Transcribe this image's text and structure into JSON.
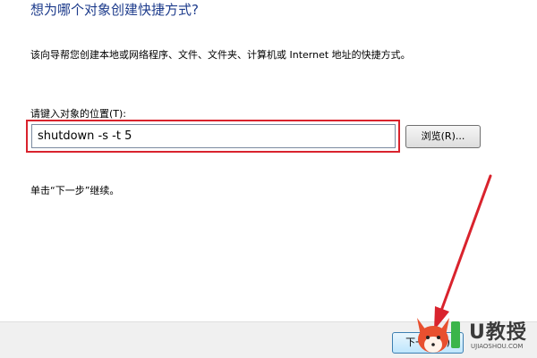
{
  "wizard": {
    "title": "想为哪个对象创建快捷方式?",
    "description": "该向导帮您创建本地或网络程序、文件、文件夹、计算机或 Internet 地址的快捷方式。",
    "location_label": "请键入对象的位置(T):",
    "location_value": "shutdown -s -t 5",
    "browse_label": "浏览(R)...",
    "instruction": "单击“下一步”继续。",
    "next_label": "下一步(N)"
  },
  "watermark": {
    "text": "U教授",
    "sub": "UJIAOSHOU.COM"
  },
  "colors": {
    "title_blue": "#1e3c8c",
    "highlight_red": "#d9232d",
    "arrow_red": "#d9232d",
    "watermark_green": "#3bb54a"
  },
  "icons": [
    "arrow-annotation",
    "fox-logo-icon"
  ]
}
